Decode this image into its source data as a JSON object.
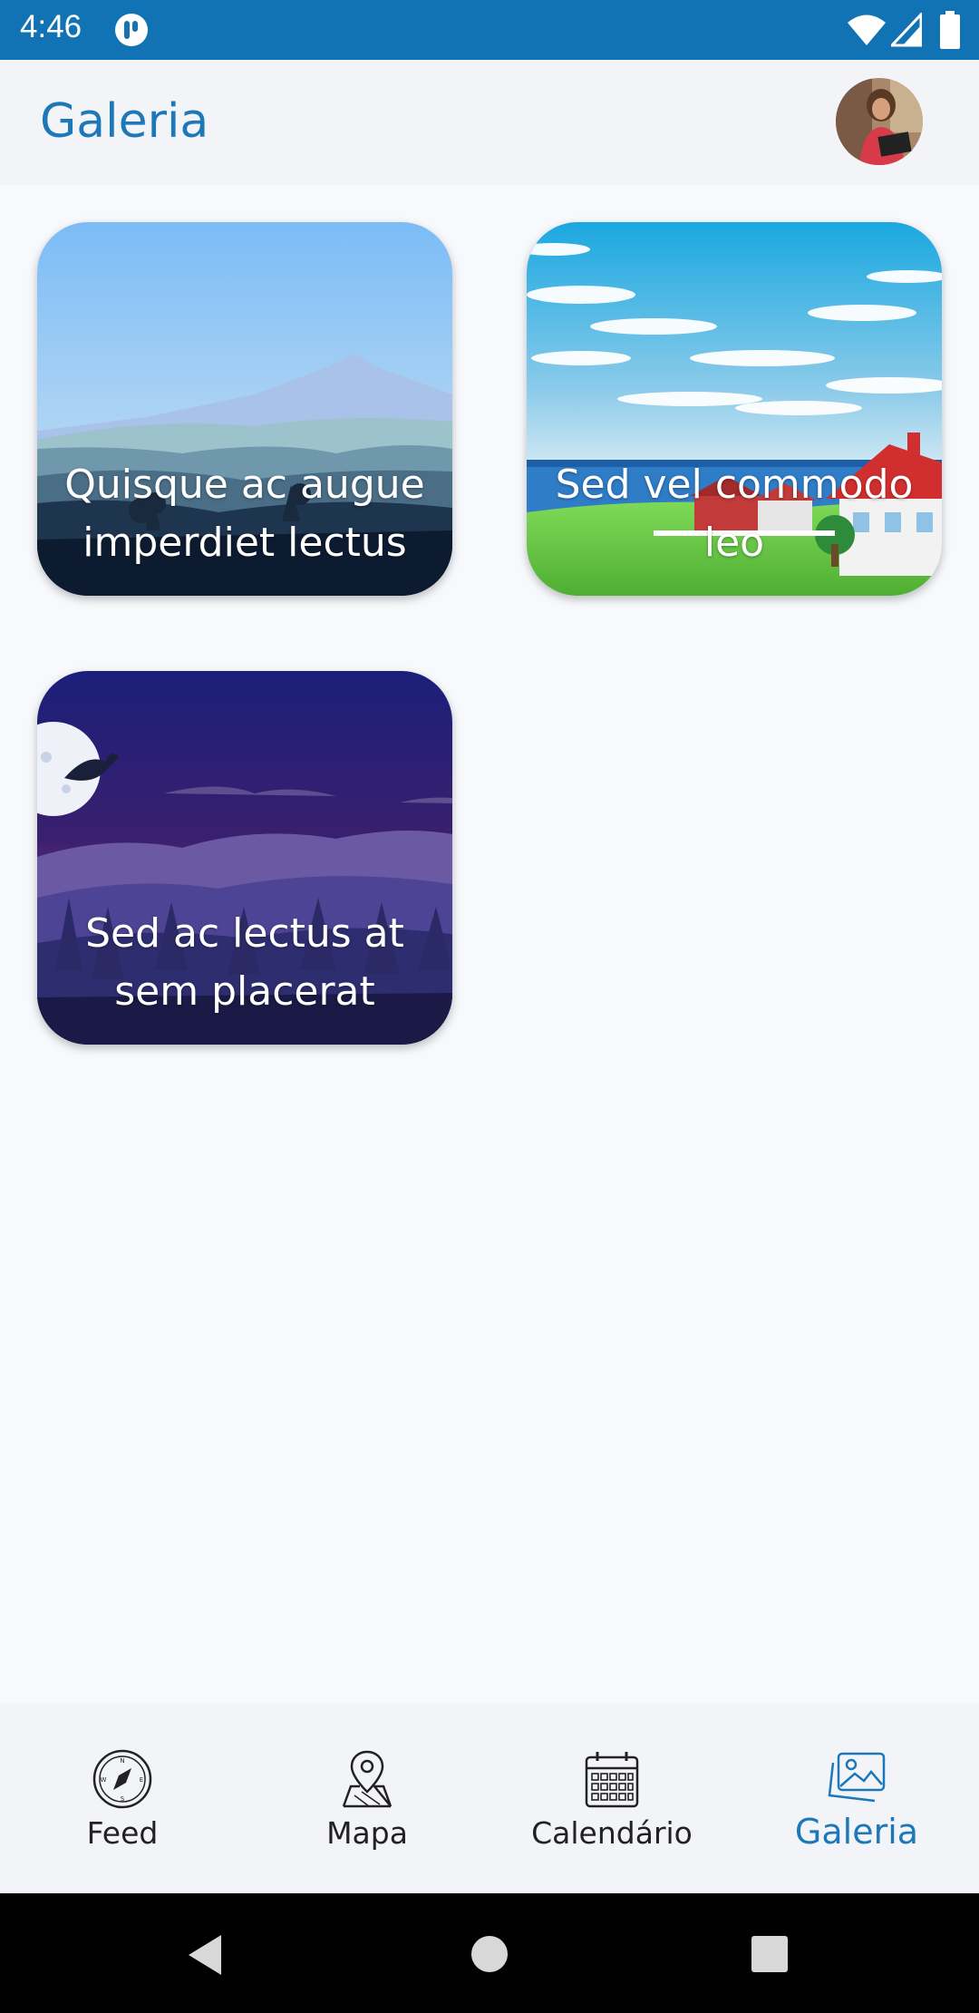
{
  "status_bar": {
    "time": "4:46"
  },
  "app_bar": {
    "title": "Galeria"
  },
  "gallery": {
    "cards": [
      {
        "caption": "Quisque ac augue imperdiet lectus"
      },
      {
        "caption": "Sed vel commodo leo"
      },
      {
        "caption": "Sed ac lectus at sem placerat"
      }
    ]
  },
  "bottom_nav": {
    "items": [
      {
        "label": "Feed",
        "icon": "compass-icon"
      },
      {
        "label": "Mapa",
        "icon": "map-pin-icon"
      },
      {
        "label": "Calendário",
        "icon": "calendar-icon"
      },
      {
        "label": "Galeria",
        "icon": "gallery-icon"
      }
    ],
    "active_index": 3
  },
  "colors": {
    "accent": "#1c78b8",
    "status_bar": "#1273b4",
    "background": "#f7f9fc"
  }
}
